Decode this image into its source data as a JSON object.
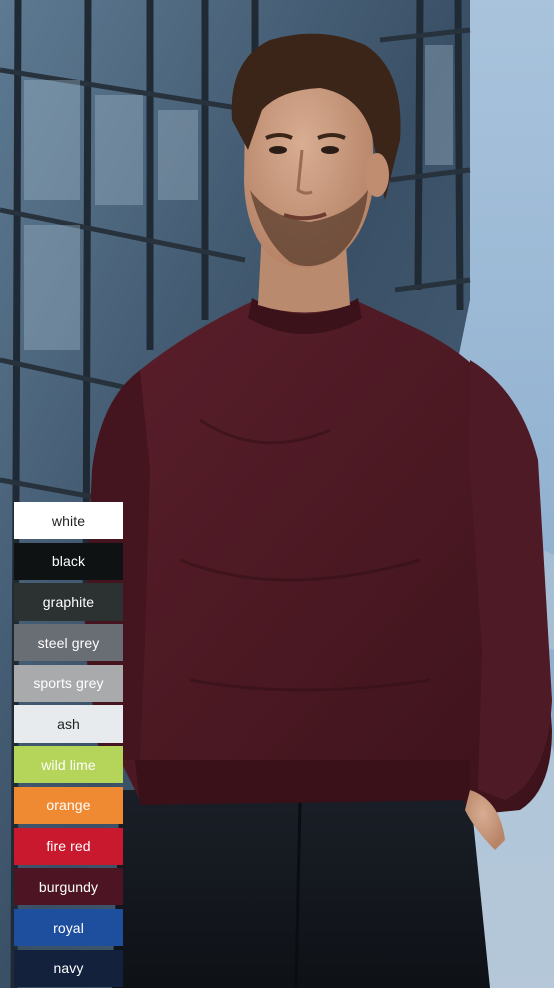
{
  "colors": {
    "sky": "#8fb0cf",
    "building": "#3d4f60",
    "sweatshirt": "#4c1822",
    "trousers": "#12161c",
    "skin": "#c89a7e",
    "hair": "#3a2518"
  },
  "swatches": [
    {
      "name": "white",
      "color": "#ffffff",
      "text_color": "#222222"
    },
    {
      "name": "black",
      "color": "#0e1213",
      "text_color": "#ffffff"
    },
    {
      "name": "graphite",
      "color": "#2c3232",
      "text_color": "#ffffff"
    },
    {
      "name": "steel grey",
      "color": "#696d74",
      "text_color": "#ffffff"
    },
    {
      "name": "sports grey",
      "color": "#a8aaab",
      "text_color": "#ffffff"
    },
    {
      "name": "ash",
      "color": "#e7ebee",
      "text_color": "#222222"
    },
    {
      "name": "wild lime",
      "color": "#b4d45a",
      "text_color": "#ffffff"
    },
    {
      "name": "orange",
      "color": "#f08a32",
      "text_color": "#ffffff"
    },
    {
      "name": "fire red",
      "color": "#c8192e",
      "text_color": "#ffffff"
    },
    {
      "name": "burgundy",
      "color": "#4d1523",
      "text_color": "#ffffff"
    },
    {
      "name": "royal",
      "color": "#1d4f9e",
      "text_color": "#ffffff"
    },
    {
      "name": "navy",
      "color": "#14213d",
      "text_color": "#ffffff"
    }
  ]
}
